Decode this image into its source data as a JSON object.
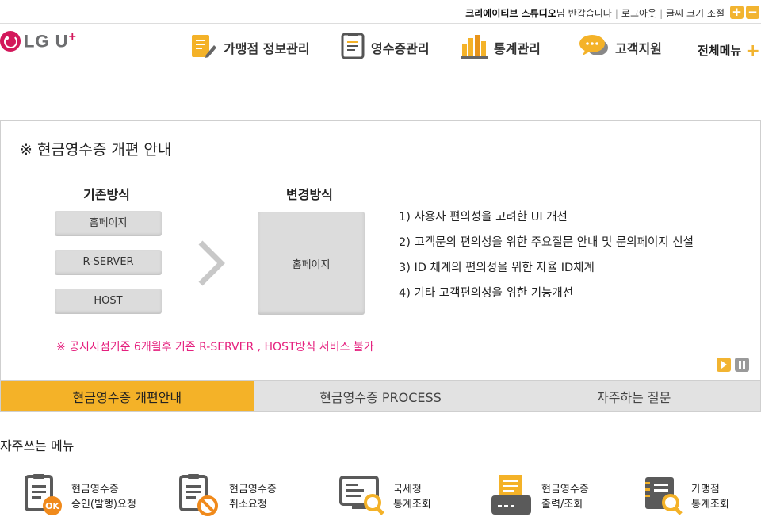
{
  "topbar": {
    "user_name": "크리에이티브 스튜디오",
    "greeting_suffix": "님 반갑습니다",
    "logout": "로그아웃",
    "font_size_label": "글씨 크기 조절",
    "font_plus": "+",
    "font_minus": "−"
  },
  "header": {
    "logo_text": "LG U",
    "logo_plus": "+",
    "nav": [
      {
        "label": "가맹점 정보관리",
        "icon": "clipboard-pen-icon"
      },
      {
        "label": "영수증관리",
        "icon": "receipt-icon"
      },
      {
        "label": "통계관리",
        "icon": "bar-chart-icon"
      },
      {
        "label": "고객지원",
        "icon": "chat-bubble-icon"
      }
    ],
    "all_menu": "전체메뉴",
    "all_menu_plus": "+"
  },
  "notice": {
    "title": "※ 현금영수증 개편 안내",
    "old_title": "기존방식",
    "old_items": [
      "홈페이지",
      "R-SERVER",
      "HOST"
    ],
    "new_title": "변경방식",
    "new_item": "홈페이지",
    "points": [
      "1) 사용자 편의성을 고려한 UI 개선",
      "2) 고객문의 편의성을 위한 주요질문 안내 및 문의페이지 신설",
      "3) ID 체계의 편의성을 위한 자율 ID체계",
      "4) 기타 고객편의성을 위한 기능개선"
    ],
    "warning": "※ 공시시점기준 6개월후 기존 R-SERVER , HOST방식 서비스 불가"
  },
  "tabs": [
    {
      "label": "현금영수증 개편안내",
      "active": true
    },
    {
      "label": "현금영수증 PROCESS",
      "active": false
    },
    {
      "label": "자주하는 질문",
      "active": false
    }
  ],
  "quick": {
    "title": "자주쓰는 메뉴",
    "items": [
      {
        "line1": "현금영수증",
        "line2": "승인(발행)요청",
        "icon": "receipt-ok-icon"
      },
      {
        "line1": "현금영수증",
        "line2": "취소요청",
        "icon": "receipt-cancel-icon"
      },
      {
        "line1": "국세청",
        "line2": "통계조회",
        "icon": "monitor-search-icon"
      },
      {
        "line1": "현금영수증",
        "line2": "출력/조회",
        "icon": "printer-icon"
      },
      {
        "line1": "가맹점",
        "line2": "통계조회",
        "icon": "document-search-icon"
      }
    ]
  },
  "colors": {
    "accent": "#f4b228",
    "brand": "#d3185b",
    "warning": "#e5207e",
    "tab_inactive": "#e2e2e2"
  }
}
